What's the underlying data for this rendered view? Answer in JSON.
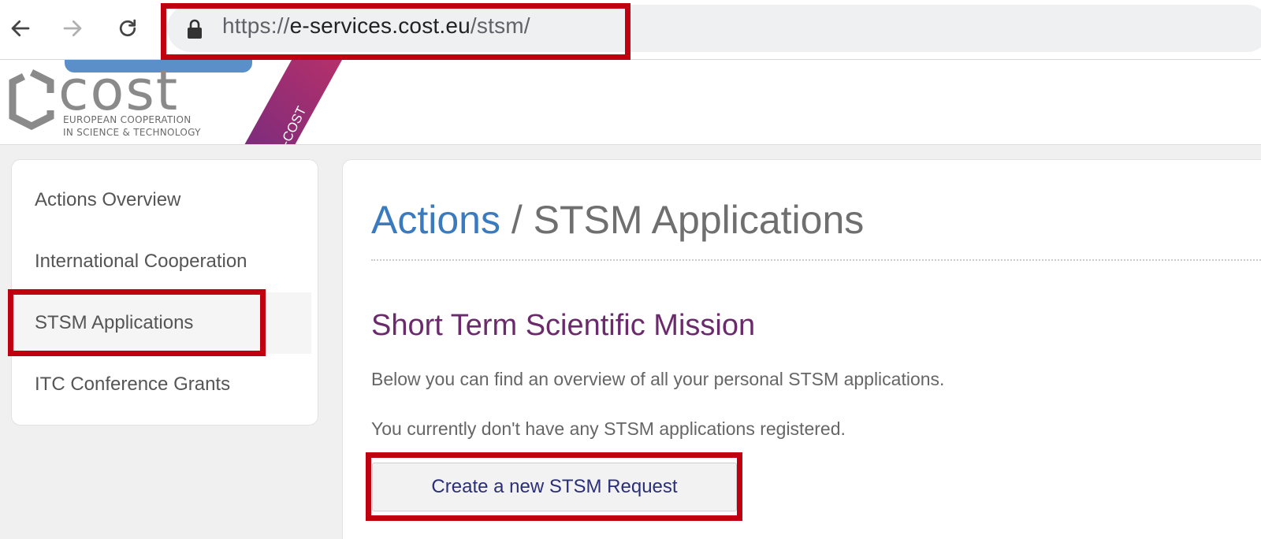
{
  "browser": {
    "back_icon": "arrow-left-icon",
    "forward_icon": "arrow-right-icon",
    "reload_icon": "reload-icon",
    "lock_icon": "lock-icon",
    "url_scheme": "https://",
    "url_host": "e-services.cost.eu",
    "url_path": "/stsm/"
  },
  "header": {
    "logo_word": "cost",
    "logo_line1": "EUROPEAN COOPERATION",
    "logo_line2": "IN SCIENCE & TECHNOLOGY",
    "ribbon_label": "e-COST"
  },
  "sidebar": {
    "items": [
      {
        "label": "Actions Overview"
      },
      {
        "label": "International Cooperation"
      },
      {
        "label": "STSM Applications"
      },
      {
        "label": "ITC Conference Grants"
      }
    ]
  },
  "main": {
    "breadcrumb_link": "Actions",
    "breadcrumb_separator": " / ",
    "page_title": "STSM Applications",
    "section_title": "Short Term Scientific Mission",
    "intro_text": "Below you can find an overview of all your personal STSM applications.",
    "empty_text": "You currently don't have any STSM applications registered.",
    "create_button": "Create a new STSM Request"
  },
  "colors": {
    "link_blue": "#3a7bbf",
    "section_purple": "#6b2a6b",
    "highlight_red": "#c00010",
    "ribbon_purple": "#a0296e"
  }
}
